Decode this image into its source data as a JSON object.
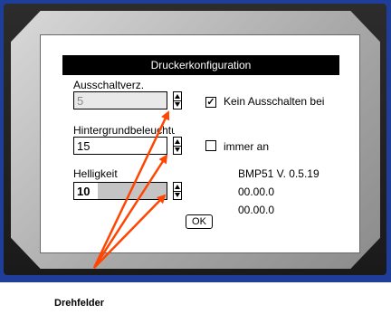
{
  "dialog": {
    "title": "Druckerkonfiguration",
    "fields": [
      {
        "label": "Ausschaltverz.",
        "value": "5",
        "state": "disabled"
      },
      {
        "label": "Hintergrundbeleuchtung",
        "value": "15",
        "state": "normal"
      },
      {
        "label": "Helligkeit",
        "value": "10",
        "state": "active"
      }
    ],
    "checkboxes": [
      {
        "label": "Kein Ausschalten bei",
        "checked": true
      },
      {
        "label": "immer an",
        "checked": false
      }
    ],
    "info_lines": [
      "BMP51 V. 0.5.19",
      "00.00.0",
      "00.00.0"
    ],
    "ok_label": "OK"
  },
  "annotation": {
    "caption": "Drehfelder",
    "arrow_color": "#ff4500"
  },
  "colors": {
    "frame": "#1f3e99",
    "title_bar": "#000000"
  }
}
